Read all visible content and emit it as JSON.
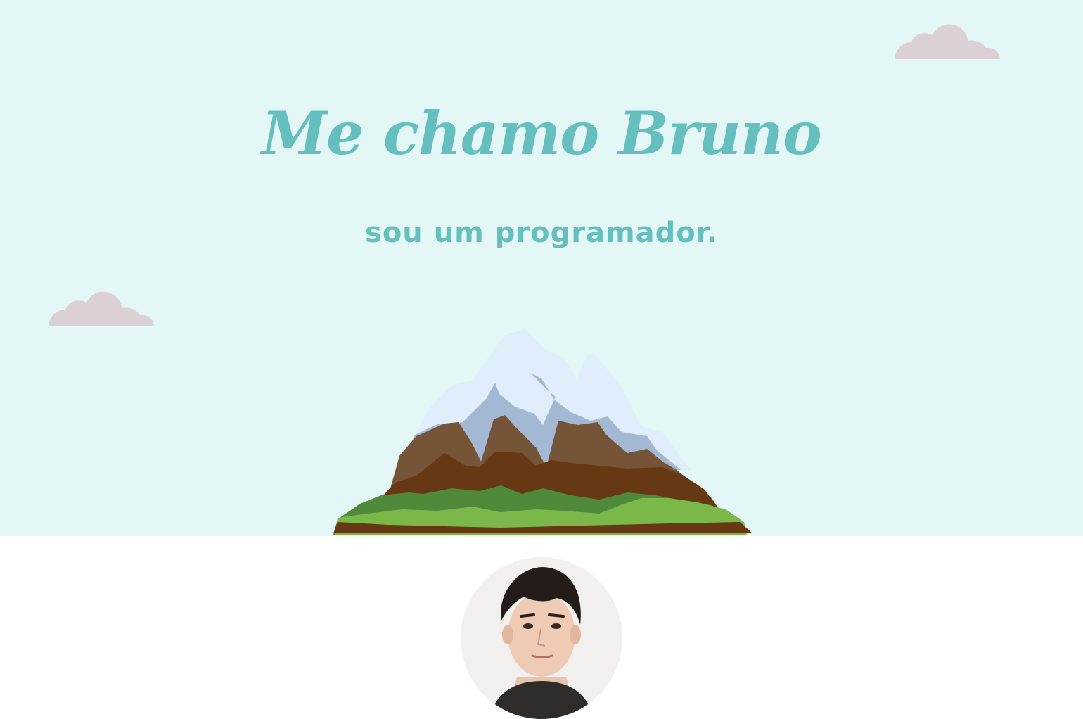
{
  "hero": {
    "title": "Me chamo Bruno",
    "subtitle": "sou um programador."
  },
  "images": {
    "cloud_top": "cloud-icon",
    "cloud_left": "cloud-icon",
    "mountain": "mountain-illustration",
    "profile": "profile-photo"
  },
  "colors": {
    "hero_background": "#e3f8f6",
    "accent": "#66bfbf",
    "cloud": "#dbd0d4",
    "page_background": "#ffffff"
  }
}
